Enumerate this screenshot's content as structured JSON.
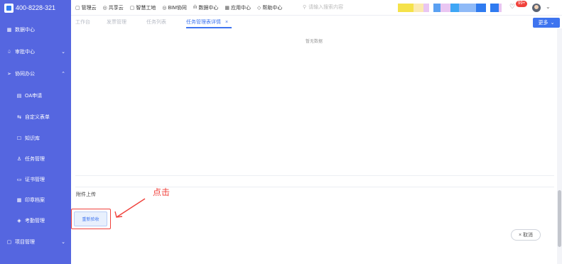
{
  "sidebar": {
    "phone": "400-8228-321",
    "items": [
      {
        "label": "数据中心",
        "icon": "grid-icon",
        "glyph": "▦",
        "chevron": ""
      },
      {
        "label": "审批中心",
        "icon": "bell-icon",
        "glyph": "♤",
        "chevron": "⌄"
      },
      {
        "label": "协同办公",
        "icon": "send-icon",
        "glyph": "➢",
        "chevron": "⌃"
      },
      {
        "label": "OA申请",
        "icon": "document-icon",
        "glyph": "▤",
        "chevron": ""
      },
      {
        "label": "自定义表单",
        "icon": "form-icon",
        "glyph": "⇆",
        "chevron": ""
      },
      {
        "label": "知识库",
        "icon": "book-icon",
        "glyph": "☐",
        "chevron": ""
      },
      {
        "label": "任务管理",
        "icon": "tasks-icon",
        "glyph": "♙",
        "chevron": ""
      },
      {
        "label": "证书管理",
        "icon": "certificate-icon",
        "glyph": "▭",
        "chevron": ""
      },
      {
        "label": "印章档案",
        "icon": "seal-icon",
        "glyph": "▦",
        "chevron": ""
      },
      {
        "label": "考勤管理",
        "icon": "attendance-icon",
        "glyph": "◈",
        "chevron": ""
      },
      {
        "label": "项目管理",
        "icon": "project-icon",
        "glyph": "▢",
        "chevron": "⌄"
      }
    ]
  },
  "topnav": {
    "items": [
      {
        "label": "管理云",
        "icon": "cloud-icon",
        "glyph": "▢"
      },
      {
        "label": "共享云",
        "icon": "share-icon",
        "glyph": "◎"
      },
      {
        "label": "智慧工地",
        "icon": "site-icon",
        "glyph": "▢"
      },
      {
        "label": "BIM协同",
        "icon": "bim-icon",
        "glyph": "◎"
      },
      {
        "label": "数据中心",
        "icon": "chart-icon",
        "glyph": "ılı"
      },
      {
        "label": "应用中心",
        "icon": "apps-icon",
        "glyph": "▦"
      },
      {
        "label": "帮助中心",
        "icon": "help-icon",
        "glyph": "◇"
      }
    ],
    "search_placeholder": "请输入搜索内容",
    "notification_count": "99+"
  },
  "tabs": {
    "items": [
      "工作台",
      "发票管理",
      "任务列表",
      "任务管理表详情"
    ],
    "close_glyph": "×",
    "more_label": "更多"
  },
  "main": {
    "empty_text": "暂无数据",
    "attachment_label": "附件上传",
    "recheck_button": "重新验收",
    "annotation_text": "点击",
    "cancel_label": "取消",
    "cancel_glyph": "×"
  },
  "colors": {
    "sidebar_bg": "#5566e0",
    "accent": "#3e74ef",
    "annotation": "#f0413b",
    "color_blocks": [
      "#f5e24a",
      "#fbeab0",
      "#e9c6f2",
      "#5aa0f2",
      "#e9c6f2",
      "#3ea6f5",
      "#8fbaf7",
      "#2f7bf0",
      "#2f7bf0",
      "#e9c6f2"
    ]
  }
}
